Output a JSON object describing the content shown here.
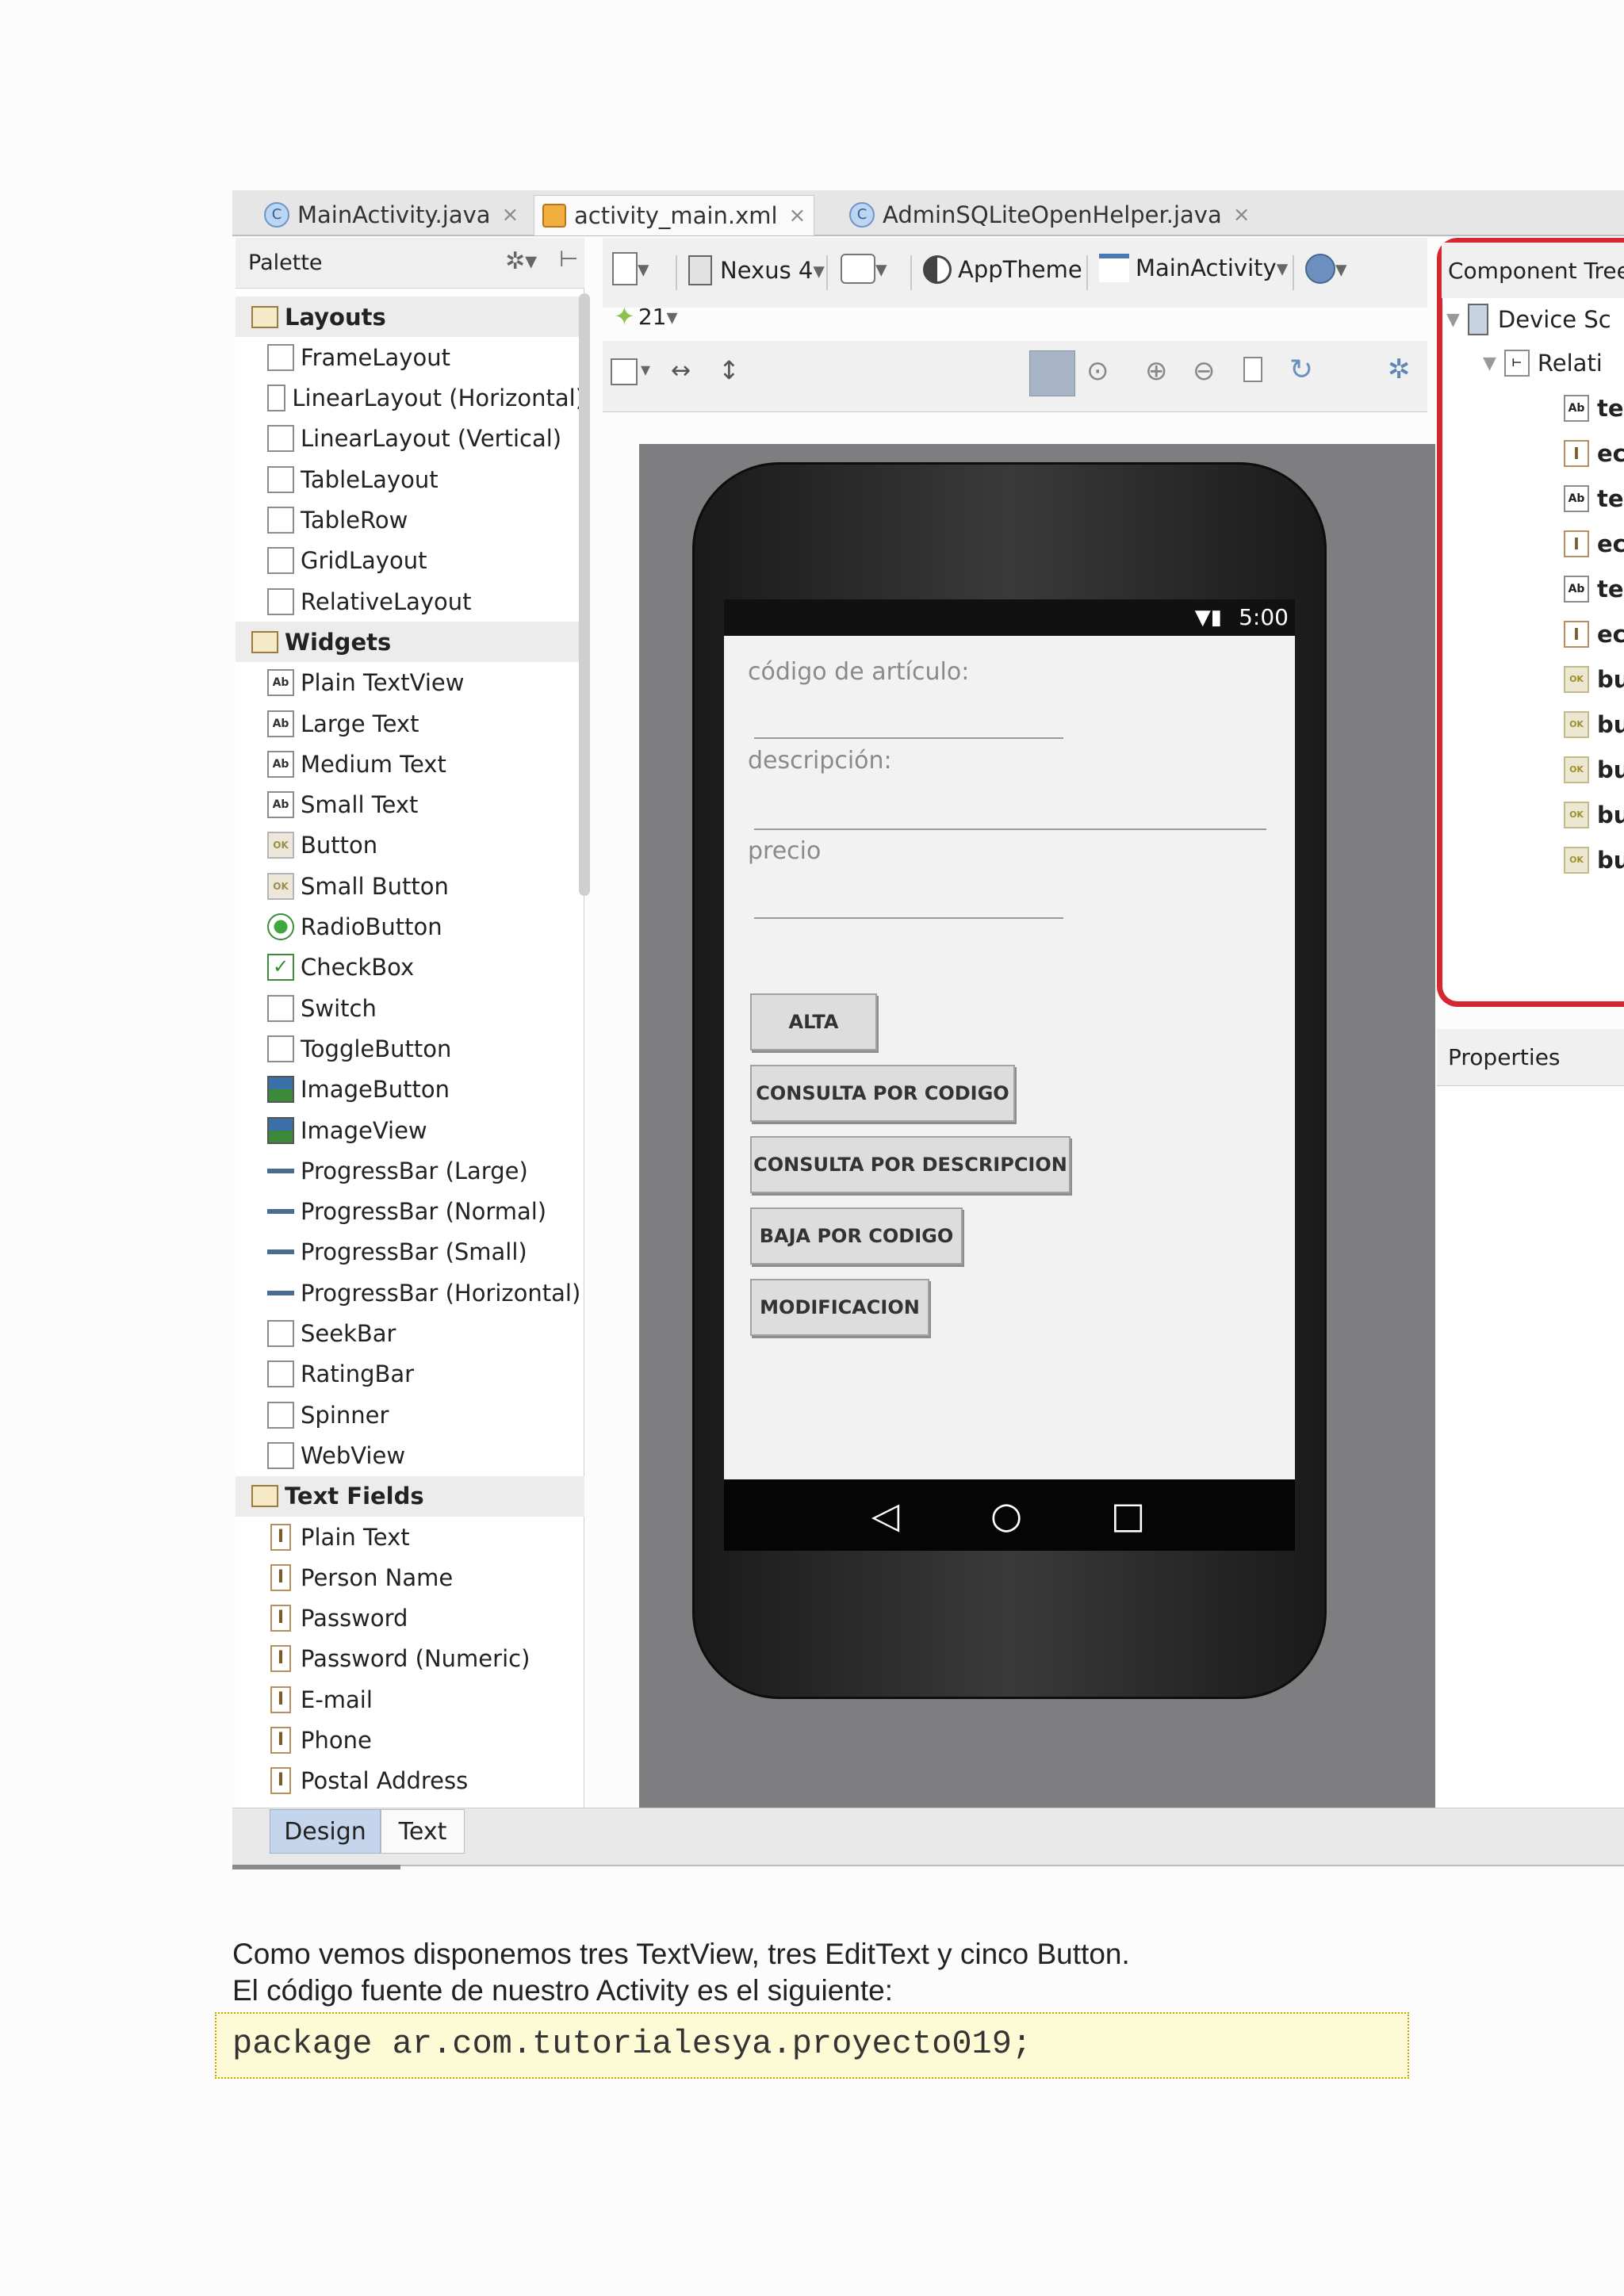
{
  "editor_tabs": [
    {
      "label": "MainActivity.java",
      "icon": "class-icon",
      "close": "×"
    },
    {
      "label": "activity_main.xml",
      "icon": "xml-file-icon",
      "close": "×"
    },
    {
      "label": "AdminSQLiteOpenHelper.java",
      "icon": "class-icon",
      "close": "×"
    }
  ],
  "palette": {
    "title": "Palette",
    "categories": [
      {
        "label": "Layouts",
        "items": [
          "FrameLayout",
          "LinearLayout (Horizontal)",
          "LinearLayout (Vertical)",
          "TableLayout",
          "TableRow",
          "GridLayout",
          "RelativeLayout"
        ]
      },
      {
        "label": "Widgets",
        "items": [
          "Plain TextView",
          "Large Text",
          "Medium Text",
          "Small Text",
          "Button",
          "Small Button",
          "RadioButton",
          "CheckBox",
          "Switch",
          "ToggleButton",
          "ImageButton",
          "ImageView",
          "ProgressBar (Large)",
          "ProgressBar (Normal)",
          "ProgressBar (Small)",
          "ProgressBar (Horizontal)",
          "SeekBar",
          "RatingBar",
          "Spinner",
          "WebView"
        ]
      },
      {
        "label": "Text Fields",
        "items": [
          "Plain Text",
          "Person Name",
          "Password",
          "Password (Numeric)",
          "E-mail",
          "Phone",
          "Postal Address"
        ]
      }
    ]
  },
  "toolbar": {
    "device": "Nexus 4",
    "api_level": "21",
    "theme": "AppTheme",
    "activity": "MainActivity"
  },
  "phone": {
    "status_time": "5:00",
    "labels": [
      "código de artículo:",
      "descripción:",
      "precio"
    ],
    "buttons": [
      "ALTA",
      "CONSULTA POR CODIGO",
      "CONSULTA POR DESCRIPCION",
      "BAJA POR CODIGO",
      "MODIFICACION"
    ]
  },
  "component_tree": {
    "title": "Component Tree",
    "root": "Device Sc",
    "layout": "Relati",
    "children": [
      {
        "icon": "Ab",
        "label": "te"
      },
      {
        "icon": "I",
        "label": "ec"
      },
      {
        "icon": "Ab",
        "label": "te"
      },
      {
        "icon": "I",
        "label": "ec"
      },
      {
        "icon": "Ab",
        "label": "te"
      },
      {
        "icon": "I",
        "label": "ec"
      },
      {
        "icon": "OK",
        "label": "bu"
      },
      {
        "icon": "OK",
        "label": "bu"
      },
      {
        "icon": "OK",
        "label": "bu"
      },
      {
        "icon": "OK",
        "label": "bu"
      },
      {
        "icon": "OK",
        "label": "bu"
      }
    ],
    "highlight_color": "#d6262f"
  },
  "properties": {
    "title": "Properties"
  },
  "bottom_tabs": {
    "design": "Design",
    "text": "Text"
  },
  "document": {
    "line1": "Como vemos disponemos tres TextView, tres EditText y cinco Button.",
    "line2": "El código fuente de nuestro Activity es el siguiente:",
    "code": "package ar.com.tutorialesya.proyecto019;"
  }
}
